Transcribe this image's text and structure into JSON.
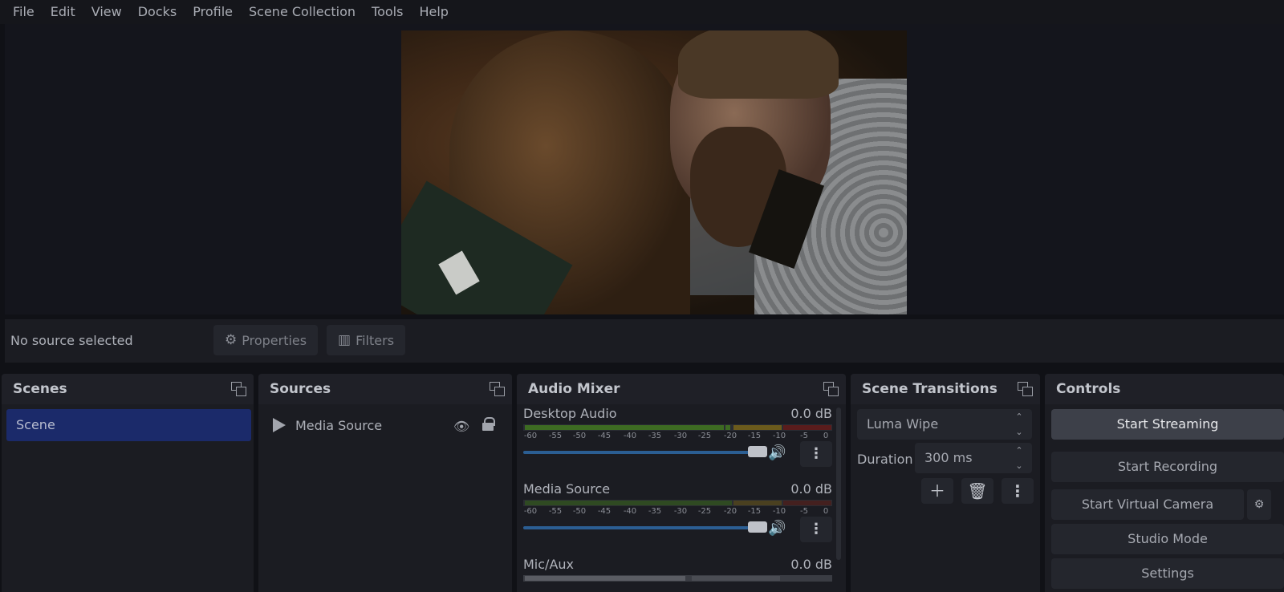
{
  "menu": [
    "File",
    "Edit",
    "View",
    "Docks",
    "Profile",
    "Scene Collection",
    "Tools",
    "Help"
  ],
  "source_bar": {
    "status": "No source selected",
    "properties_label": "Properties",
    "filters_label": "Filters"
  },
  "docks": {
    "scenes": {
      "title": "Scenes",
      "items": [
        "Scene"
      ]
    },
    "sources": {
      "title": "Sources",
      "items": [
        "Media Source"
      ]
    },
    "mixer": {
      "title": "Audio Mixer",
      "scale": [
        "-60",
        "-55",
        "-50",
        "-45",
        "-40",
        "-35",
        "-30",
        "-25",
        "-20",
        "-15",
        "-10",
        "-5",
        "0"
      ],
      "channels": [
        {
          "name": "Desktop Audio",
          "db": "0.0 dB"
        },
        {
          "name": "Media Source",
          "db": "0.0 dB"
        },
        {
          "name": "Mic/Aux",
          "db": "0.0 dB"
        }
      ]
    },
    "transitions": {
      "title": "Scene Transitions",
      "selected": "Luma Wipe",
      "duration_label": "Duration",
      "duration_value": "300 ms"
    },
    "controls": {
      "title": "Controls",
      "buttons": [
        "Start Streaming",
        "Start Recording",
        "Start Virtual Camera",
        "Studio Mode",
        "Settings"
      ]
    }
  },
  "colors": {
    "accent_selected": "#1b2a6a",
    "volume_bar": "#2b5e93",
    "meter_green": "#3d6b22",
    "meter_yellow": "#6b5a1c",
    "meter_red": "#5a1c1c"
  }
}
